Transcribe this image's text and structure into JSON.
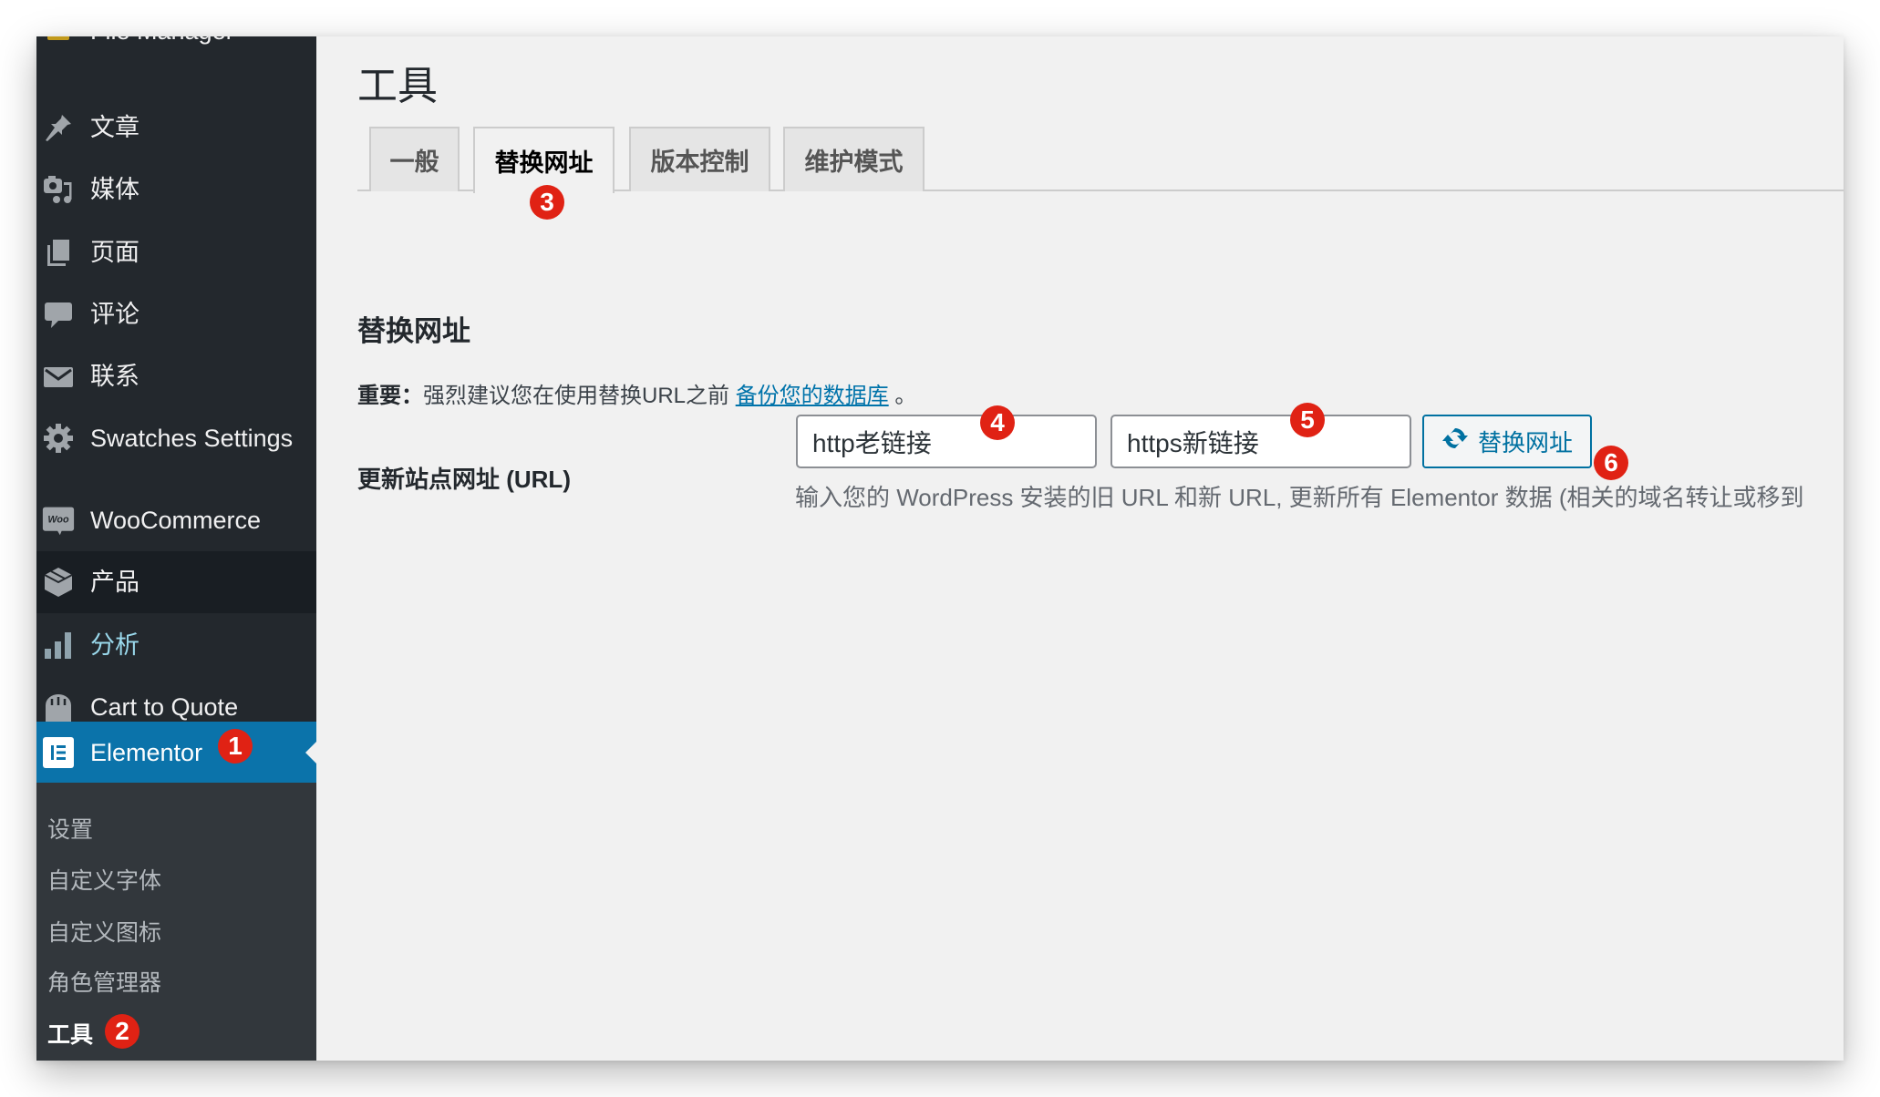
{
  "sidebar": {
    "items": [
      {
        "label": "File Manager",
        "icon": "folder-icon"
      },
      {
        "label": "文章",
        "icon": "pin-icon"
      },
      {
        "label": "媒体",
        "icon": "media-icon"
      },
      {
        "label": "页面",
        "icon": "pages-icon"
      },
      {
        "label": "评论",
        "icon": "comment-icon"
      },
      {
        "label": "联系",
        "icon": "mail-icon"
      },
      {
        "label": "Swatches Settings",
        "icon": "gear-icon"
      },
      {
        "label": "WooCommerce",
        "icon": "woo-icon",
        "icon_text": "Woo"
      },
      {
        "label": "产品",
        "icon": "box-icon"
      },
      {
        "label": "分析",
        "icon": "bar-chart-icon"
      },
      {
        "label": "Cart to Quote",
        "icon": "bag-icon"
      },
      {
        "label": "Elementor",
        "icon": "elementor-icon",
        "badge": "1"
      }
    ],
    "submenu": [
      {
        "label": "设置"
      },
      {
        "label": "自定义字体"
      },
      {
        "label": "自定义图标"
      },
      {
        "label": "角色管理器"
      },
      {
        "label": "工具",
        "badge": "2"
      }
    ]
  },
  "page": {
    "title": "工具",
    "tabs": [
      {
        "label": "一般"
      },
      {
        "label": "替换网址",
        "badge": "3"
      },
      {
        "label": "版本控制"
      },
      {
        "label": "维护模式"
      }
    ],
    "section_title": "替换网址",
    "notice": {
      "strong": "重要：",
      "text": "强烈建议您在使用替换URL之前 ",
      "link": "备份您的数据库",
      "suffix": " 。"
    },
    "field_label": "更新站点网址 (URL)",
    "old_url": {
      "value": "http老链接",
      "badge": "4"
    },
    "new_url": {
      "value": "https新链接",
      "badge": "5"
    },
    "replace_button": {
      "label": "替换网址",
      "icon": "refresh-icon",
      "badge": "6"
    },
    "description": "输入您的 WordPress 安装的旧 URL 和新 URL, 更新所有 Elementor 数据 (相关的域名转让或移到"
  },
  "colors": {
    "sidebar_bg": "#23282d",
    "submenu_bg": "#32373c",
    "current_bg": "#0b73aa",
    "badge": "#e02214",
    "link": "#0073aa",
    "content_bg": "#f1f1f1"
  }
}
